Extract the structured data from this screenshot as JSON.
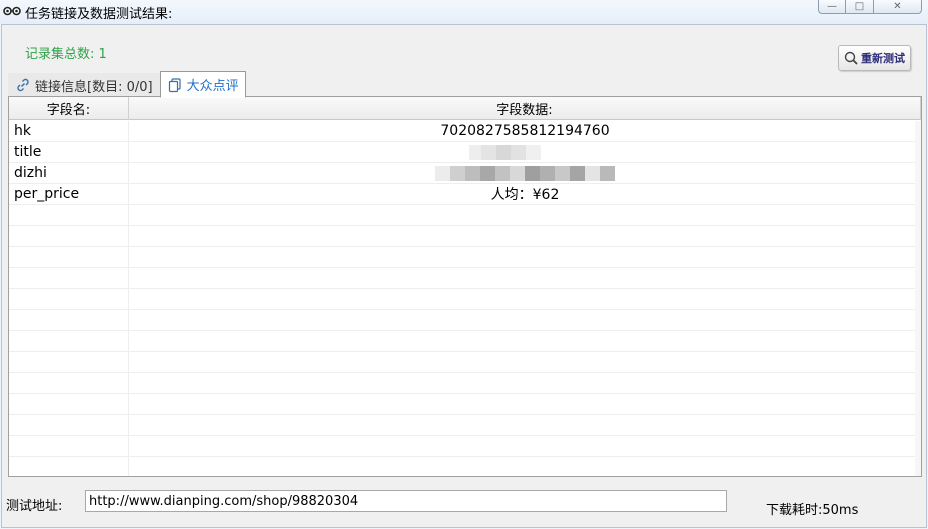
{
  "window": {
    "title": "任务链接及数据测试结果:",
    "controls": {
      "minimize": "—",
      "maximize": "□",
      "close": "✕"
    }
  },
  "summary": {
    "total_records": "记录集总数: 1"
  },
  "toolbar": {
    "retest_label": "重新测试"
  },
  "tabs": [
    {
      "label": "链接信息[数目: 0/0]",
      "icon": "link-icon",
      "active": false
    },
    {
      "label": "大众点评",
      "icon": "copy-pages-icon",
      "active": true
    }
  ],
  "grid": {
    "columns": [
      "字段名:",
      "字段数据:"
    ],
    "rows": [
      {
        "field": "hk",
        "value": "7020827585812194760"
      },
      {
        "field": "title",
        "value": ""
      },
      {
        "field": "dizhi",
        "value": ""
      },
      {
        "field": "per_price",
        "value": "人均：¥62"
      }
    ]
  },
  "footer": {
    "url_label": "测试地址:",
    "url_value": "http://www.dianping.com/shop/98820304",
    "download_time": "下载耗时:50ms"
  },
  "colors": {
    "accent_green": "#2fa34a",
    "tab_active_text": "#1f6fc9"
  }
}
